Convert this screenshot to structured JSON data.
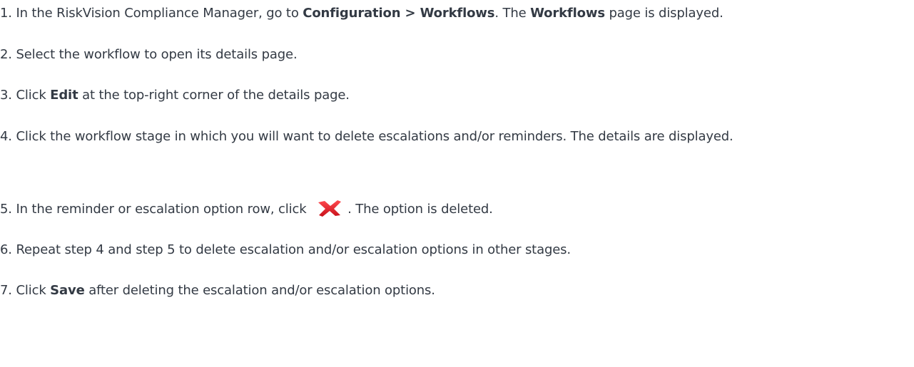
{
  "steps": [
    {
      "num": "1.",
      "t1": " In the RiskVision Compliance Manager, go to ",
      "b1": "Configuration > Workflows",
      "t2": ". The ",
      "b2": "Workflows",
      "t3": " page is displayed."
    },
    {
      "num": "2.",
      "t1": " Select the workflow to open its details page."
    },
    {
      "num": "3.",
      "t1": " Click ",
      "b1": "Edit",
      "t2": " at the top-right corner of the details page."
    },
    {
      "num": "4.",
      "t1": " Click the workflow stage in which you will want to delete escalations and/or reminders. The details are displayed."
    },
    {
      "num": "5.",
      "t1": " In the reminder or escalation option row, click ",
      "t2": ". The option is deleted."
    },
    {
      "num": "6.",
      "t1": " Repeat step 4 and step 5 to delete escalation and/or escalation options in other stages."
    },
    {
      "num": "7.",
      "t1": " Click ",
      "b1": "Save",
      "t2": " after deleting the escalation and/or escalation options."
    }
  ],
  "icons": {
    "delete": "delete-x-icon",
    "delete_color": "#e0141e"
  }
}
